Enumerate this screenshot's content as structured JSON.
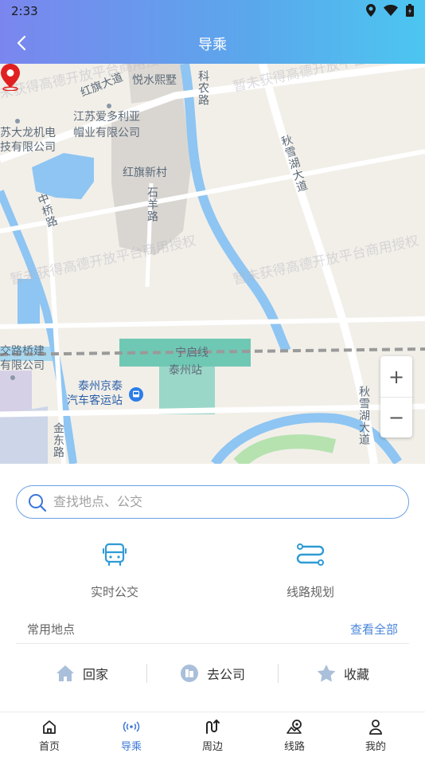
{
  "status_bar": {
    "time": "2:33"
  },
  "header": {
    "title": "导乘"
  },
  "map": {
    "labels": {
      "hongqi_avenue": "红旗大道",
      "yueshui": "悦水熙墅",
      "kenong_road": "科农路",
      "aiduoli_line1": "江苏爱多利亚",
      "aiduoli_line2": "帽业有限公司",
      "dalong_line1": "苏大龙机电",
      "dalong_line2": "技有限公司",
      "qiuxuehu_avenue_top": "秋雪湖大道",
      "hongqi_village": "红旗新村",
      "shiyang_road": "石羊路",
      "zhongqiao_road": "中桥路",
      "jiaolu_line1": "交路桥建",
      "jiaolu_line2": "有限公司",
      "ningqi_line": "宁启线",
      "taizhou_station": "泰州站",
      "jingtai_line1": "泰州京泰",
      "jingtai_line2": "汽车客运站",
      "qiuxuehu_avenue_bottom": "秋雪湖大道",
      "jindong_road": "金东路"
    },
    "watermark": "暂未获得高德开放平台商用授权",
    "zoom_in": "+",
    "zoom_out": "−"
  },
  "search": {
    "placeholder": "查找地点、公交"
  },
  "quick_actions": [
    {
      "label": "实时公交",
      "icon": "bus-icon"
    },
    {
      "label": "线路规划",
      "icon": "route-icon"
    }
  ],
  "favorites": {
    "title": "常用地点",
    "view_all": "查看全部",
    "items": [
      {
        "label": "回家",
        "icon": "home-icon"
      },
      {
        "label": "去公司",
        "icon": "company-icon"
      },
      {
        "label": "收藏",
        "icon": "star-icon"
      }
    ]
  },
  "tabbar": {
    "items": [
      {
        "label": "首页",
        "icon": "home-outline-icon"
      },
      {
        "label": "导乘",
        "icon": "signal-icon"
      },
      {
        "label": "周边",
        "icon": "nearby-icon"
      },
      {
        "label": "线路",
        "icon": "map-route-icon"
      },
      {
        "label": "我的",
        "icon": "user-icon"
      }
    ],
    "active": "导乘"
  },
  "colors": {
    "accent": "#3b76d8",
    "header_start": "#7a86ee",
    "header_end": "#4cc6f0",
    "pin": "#e02020"
  }
}
